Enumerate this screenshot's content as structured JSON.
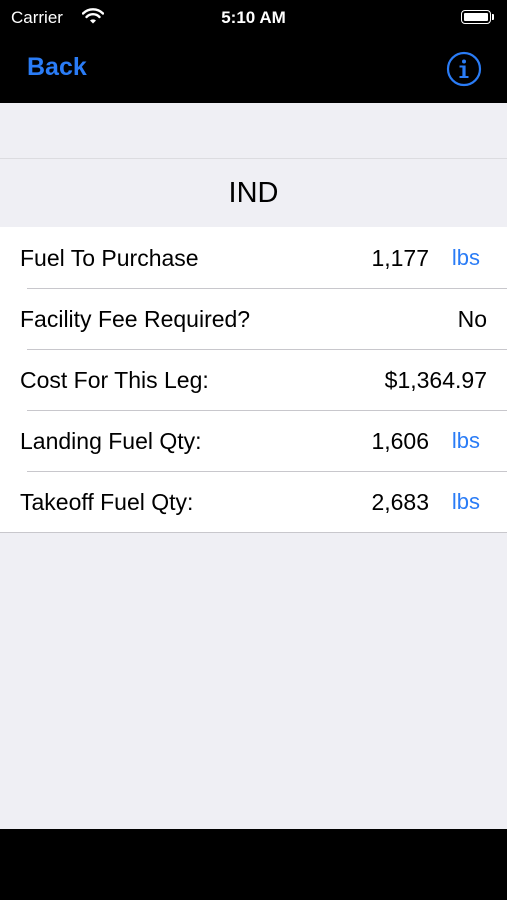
{
  "status_bar": {
    "carrier": "Carrier",
    "time": "5:10 AM"
  },
  "nav": {
    "back_label": "Back",
    "info_icon": "info-circle-icon"
  },
  "section": {
    "title": "IND"
  },
  "rows": [
    {
      "label": "Fuel To Purchase",
      "value": "1,177",
      "unit": "lbs"
    },
    {
      "label": "Facility Fee Required?",
      "value": "No",
      "unit": ""
    },
    {
      "label": "Cost For This Leg:",
      "value": "$1,364.97",
      "unit": ""
    },
    {
      "label": "Landing Fuel Qty:",
      "value": "1,606",
      "unit": "lbs"
    },
    {
      "label": "Takeoff Fuel Qty:",
      "value": "2,683",
      "unit": "lbs"
    }
  ],
  "colors": {
    "accent": "#2a7cf6",
    "background": "#efeff4",
    "bar": "#000000"
  }
}
